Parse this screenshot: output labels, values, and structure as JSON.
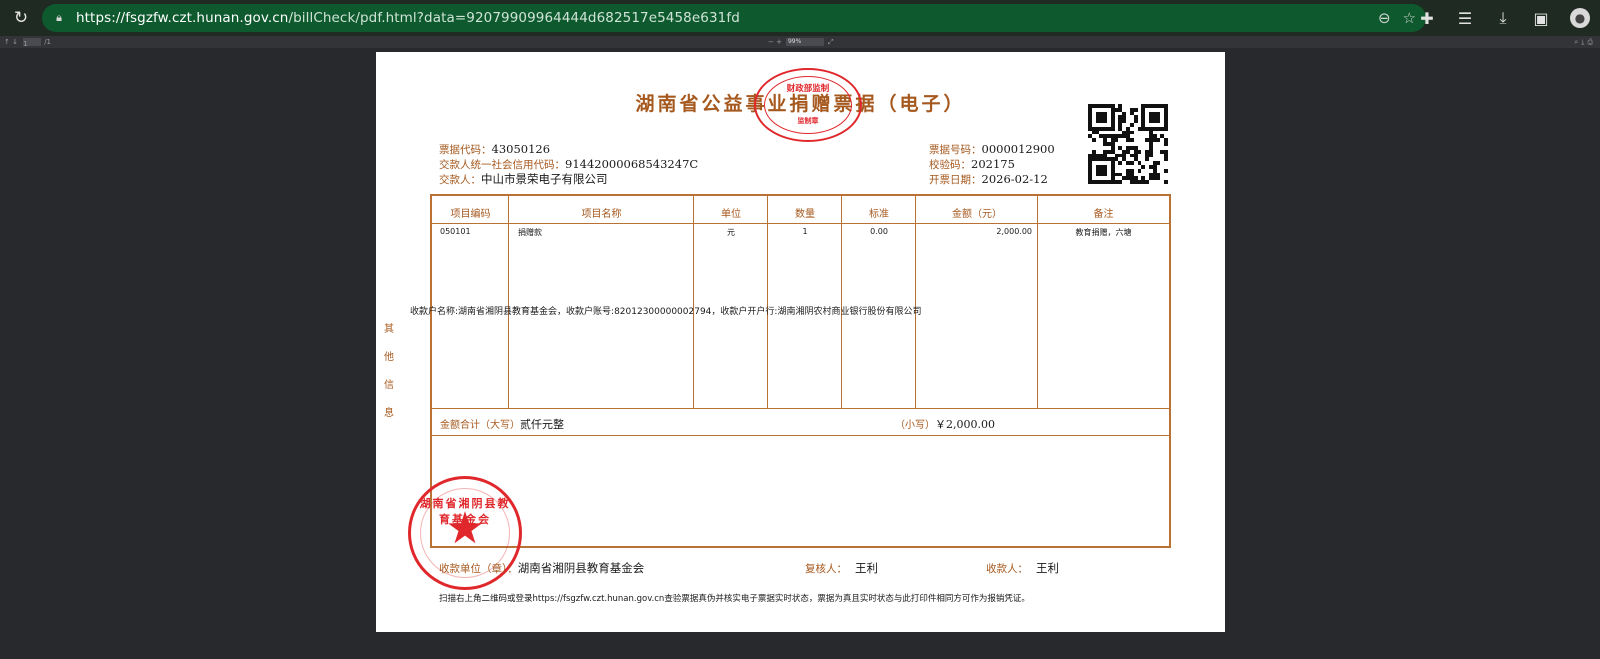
{
  "browser": {
    "url_host": "https://fsgzfw.czt.hunan.gov.cn",
    "url_path": "/billCheck/pdf.html?data=92079909964444d682517e5458e631fd",
    "icons": [
      "reload-icon",
      "lock-icon",
      "zoom-out-icon",
      "star-icon",
      "extensions-icon",
      "favorites-icon",
      "downloads-icon",
      "screenshot-icon",
      "avatar-icon"
    ]
  },
  "pdf_toolbar": {
    "page_num": "1",
    "page_total": "/1",
    "zoom_minus": "−",
    "zoom_plus": "+",
    "zoom_value": "99%"
  },
  "receipt": {
    "title": "湖南省公益事业捐赠票据（电子）",
    "seal_top_line1": "财政部监制",
    "seal_top_line2": "监制章",
    "code_label": "票据代码：",
    "code_value": "43050126",
    "payer_id_label": "交款人统一社会信用代码：",
    "payer_id_value": "91442000068543247C",
    "payer_label": "交款人：",
    "payer_value": "中山市景荣电子有限公司",
    "no_label": "票据号码：",
    "no_value": "0000012900",
    "check_label": "校验码：",
    "check_value": "202175",
    "date_label": "开票日期：",
    "date_value": "2026-02-12",
    "table": {
      "headers": [
        "项目编码",
        "项目名称",
        "单位",
        "数量",
        "标准",
        "金额（元）",
        "备注"
      ],
      "row": [
        "050101",
        "捐赠款",
        "元",
        "1",
        "0.00",
        "2,000.00",
        "教育捐赠，六塘"
      ]
    },
    "total_upper_label": "金额合计（大写）",
    "total_upper_value": "贰仟元整",
    "total_lower_label": "（小写）",
    "total_lower_value": "￥2,000.00",
    "remark_text": "收款户名称:湖南省湘阴县教育基金会，收款户账号:82012300000002794，收款户开户行:湖南湘阴农村商业银行股份有限公司",
    "remark_side": [
      "其",
      "他",
      "信",
      "息"
    ],
    "seal_big_text": "湖南省湘阴县教育基金会",
    "seal_big_star": "★",
    "receiver_label": "收款单位（章）：",
    "receiver_value": "湖南省湘阴县教育基金会",
    "reviewer_label": "复核人：",
    "reviewer_value": "王利",
    "collector_label": "收款人：",
    "collector_value": "王利",
    "note": "扫描右上角二维码或登录https://fsgzfw.czt.hunan.gov.cn查验票据真伪并核实电子票据实时状态，票据为真且实时状态与此打印件相同方可作为报销凭证。"
  },
  "colors": {
    "accent": "#a6591e",
    "seal": "#e0282c",
    "chrome": "#0e5a2e"
  }
}
